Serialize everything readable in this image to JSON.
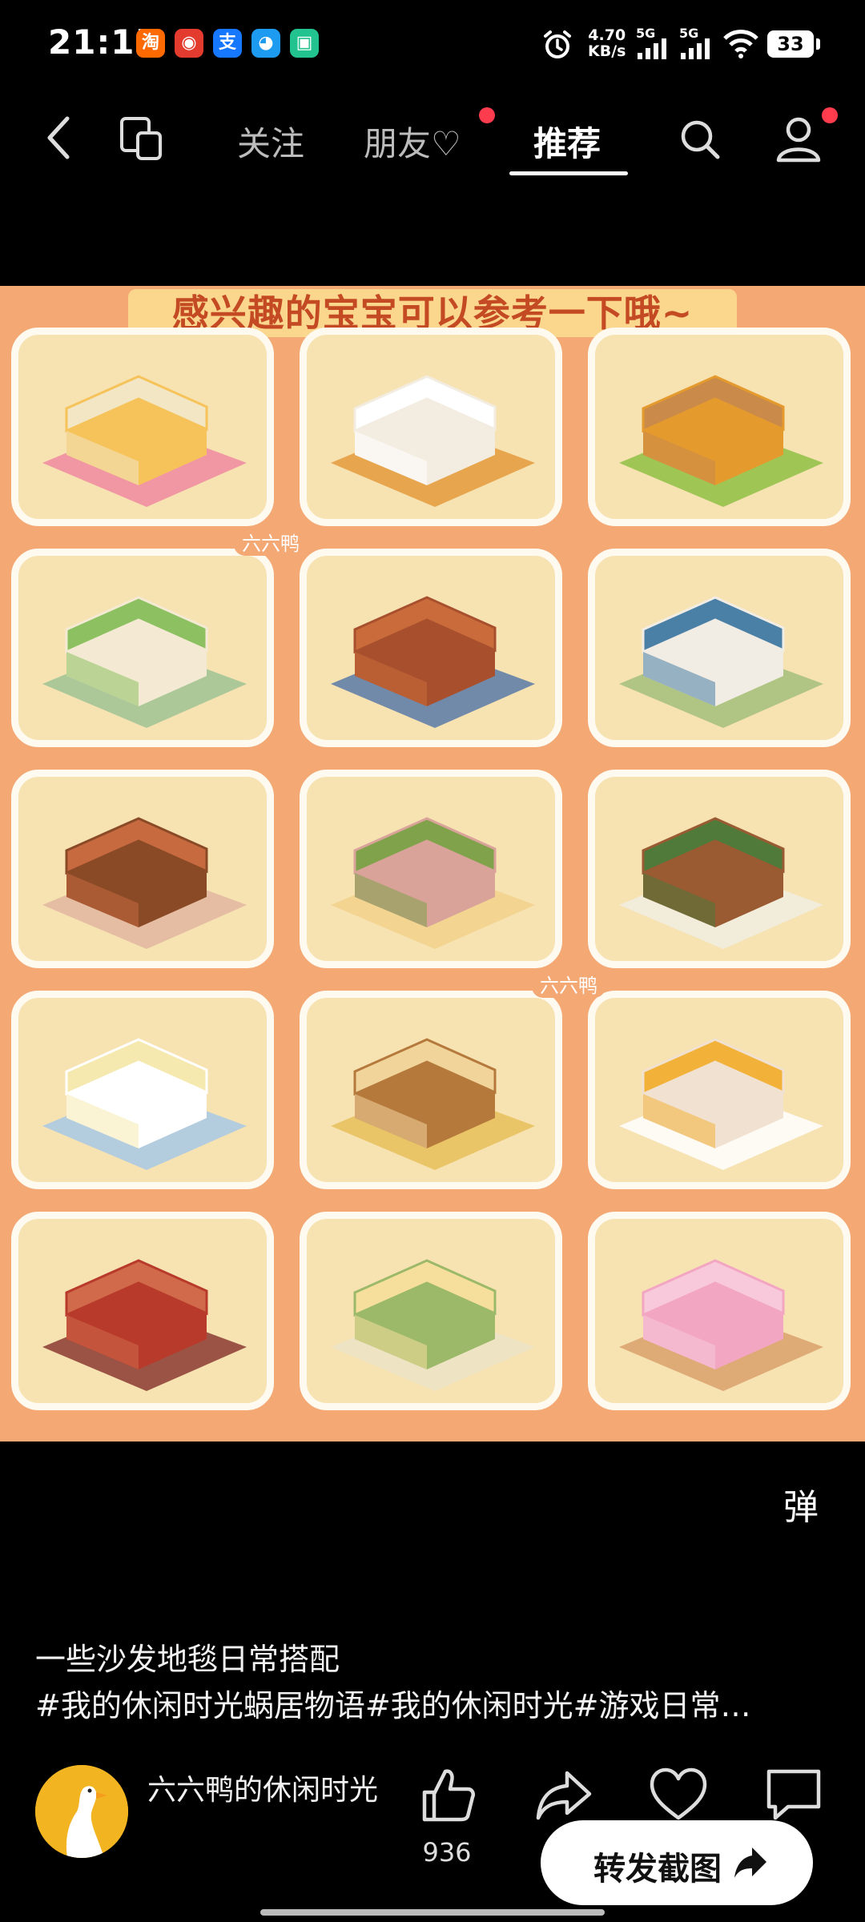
{
  "status_bar": {
    "time": "21:15",
    "apps": [
      {
        "icon": "taobao-icon",
        "glyph": "淘",
        "color": "#ff6a00"
      },
      {
        "icon": "app-red-icon",
        "glyph": "◉",
        "color": "#e33b2e"
      },
      {
        "icon": "alipay-icon",
        "glyph": "支",
        "color": "#1677ff"
      },
      {
        "icon": "qq-icon",
        "glyph": "◕",
        "color": "#1d9bf0"
      },
      {
        "icon": "green-cube-icon",
        "glyph": "▣",
        "color": "#22c38e"
      }
    ],
    "net_speed_value": "4.70",
    "net_speed_unit": "KB/s",
    "signal1_label": "5G",
    "signal2_label": "5G",
    "battery": "33"
  },
  "nav": {
    "tabs": [
      {
        "label": "关注",
        "active": false
      },
      {
        "label": "朋友♡",
        "active": false
      },
      {
        "label": "推荐",
        "active": true
      }
    ]
  },
  "content": {
    "banner": "感兴趣的宝宝可以参考一下哦~",
    "watermark_1": "六六鸭",
    "watermark_2": "六六鸭",
    "cards": [
      {
        "icon": "yellow-sofa-heart-pillow-icon"
      },
      {
        "icon": "calico-cat-sofa-icon"
      },
      {
        "icon": "orange-armchairs-round-rug-icon"
      },
      {
        "icon": "cream-armchair-flower-rug-icon"
      },
      {
        "icon": "brown-blanket-sofa-icon"
      },
      {
        "icon": "white-bench-blue-pillows-icon"
      },
      {
        "icon": "brown-leather-armchairs-icon"
      },
      {
        "icon": "pink-vine-sofa-icon"
      },
      {
        "icon": "wooden-bench-plant-icon"
      },
      {
        "icon": "white-sofa-star-rug-icon"
      },
      {
        "icon": "wooden-chair-round-rug-icon"
      },
      {
        "icon": "egg-chairs-icon"
      },
      {
        "icon": "red-chaise-lounge-icon"
      },
      {
        "icon": "green-sofa-icon"
      },
      {
        "icon": "pink-flower-bench-icon"
      }
    ]
  },
  "danmu_label": "弹",
  "caption": {
    "line1": "一些沙发地毯日常搭配",
    "line2": "#我的休闲时光蜗居物语#我的休闲时光#游戏日常…"
  },
  "author": {
    "name": "六六鸭的休闲时光"
  },
  "actions": {
    "like_count": "936"
  },
  "share_button_label": "转发截图"
}
